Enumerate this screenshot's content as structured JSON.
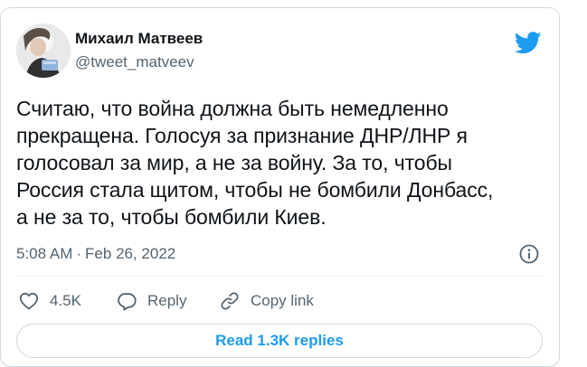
{
  "author": {
    "name": "Михаил Матвеев",
    "handle": "@tweet_matveev",
    "avatar_icon": "user-photo-avatar"
  },
  "brand": {
    "logo_icon": "twitter-bird-icon",
    "color": "#1d9bf0"
  },
  "tweet": {
    "text": "Считаю, что война должна быть немедленно\nпрекращена. Голосуя за признание ДНР/ЛНР я\nголосовал за мир, а не за войну. За то, чтобы\nРоссия стала щитом, чтобы не бомбили Донбасс,\nа не за то, чтобы бомбили Киев.",
    "time": "5:08 AM",
    "separator": "·",
    "date": "Feb 26, 2022",
    "info_icon": "info-icon"
  },
  "actions": {
    "like": {
      "icon": "heart-icon",
      "count": "4.5K"
    },
    "reply": {
      "icon": "reply-bubble-icon",
      "label": "Reply"
    },
    "copy_link": {
      "icon": "link-icon",
      "label": "Copy link"
    }
  },
  "replies_button": {
    "label": "Read 1.3K replies"
  },
  "colors": {
    "text_primary": "#0f1419",
    "text_secondary": "#536471",
    "border": "#cfd9de",
    "accent": "#1d9bf0"
  }
}
